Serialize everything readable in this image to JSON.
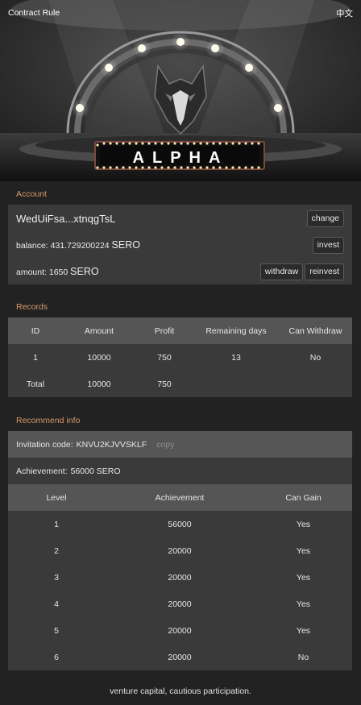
{
  "topbar": {
    "rule_label": "Contract Rule",
    "lang_label": "中文"
  },
  "hero": {
    "title": "ALPHA"
  },
  "account": {
    "section_title": "Account",
    "name": "WedUiFsa...xtnqgTsL",
    "change_label": "change",
    "balance_label": "balance:",
    "balance_value": "431.729200224",
    "balance_unit": "SERO",
    "invest_label": "invest",
    "amount_label": "amount:",
    "amount_value": "1650",
    "amount_unit": "SERO",
    "withdraw_label": "withdraw",
    "reinvest_label": "reinvest"
  },
  "records": {
    "section_title": "Records",
    "headers": [
      "ID",
      "Amount",
      "Profit",
      "Remaining days",
      "Can Withdraw"
    ],
    "rows": [
      [
        "1",
        "10000",
        "750",
        "13",
        "No"
      ],
      [
        "Total",
        "10000",
        "750",
        "",
        ""
      ]
    ]
  },
  "recommend": {
    "section_title": "Recommend info",
    "invitation_label": "Invitation code:",
    "invitation_code": "KNVU2KJVVSKLF",
    "copy_label": "copy",
    "achievement_label": "Achievement:",
    "achievement_value": "56000 SERO",
    "headers": [
      "Level",
      "Achievement",
      "Can Gain"
    ],
    "rows": [
      [
        "1",
        "56000",
        "Yes"
      ],
      [
        "2",
        "20000",
        "Yes"
      ],
      [
        "3",
        "20000",
        "Yes"
      ],
      [
        "4",
        "20000",
        "Yes"
      ],
      [
        "5",
        "20000",
        "Yes"
      ],
      [
        "6",
        "20000",
        "No"
      ]
    ]
  },
  "footer": {
    "text": "venture capital, cautious participation."
  },
  "colors": {
    "accent": "#d79a6a",
    "panel": "#3a3a3a",
    "header": "#555555",
    "background": "#222222"
  }
}
